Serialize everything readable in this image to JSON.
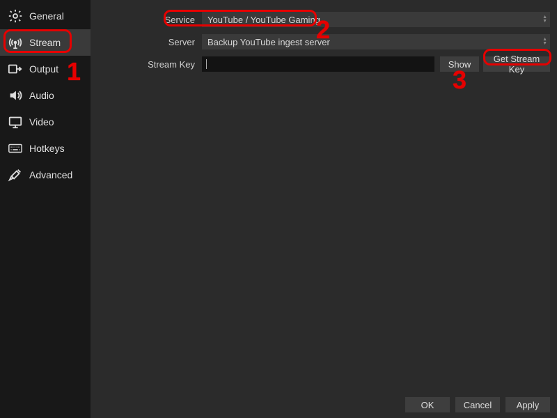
{
  "sidebar": {
    "items": [
      {
        "label": "General",
        "icon": "gear-icon"
      },
      {
        "label": "Stream",
        "icon": "antenna-icon",
        "active": true
      },
      {
        "label": "Output",
        "icon": "output-icon"
      },
      {
        "label": "Audio",
        "icon": "speaker-icon"
      },
      {
        "label": "Video",
        "icon": "monitor-icon"
      },
      {
        "label": "Hotkeys",
        "icon": "keyboard-icon"
      },
      {
        "label": "Advanced",
        "icon": "tools-icon"
      }
    ]
  },
  "form": {
    "service_label": "Service",
    "service_value": "YouTube / YouTube Gaming",
    "server_label": "Server",
    "server_value": "Backup YouTube ingest server",
    "streamkey_label": "Stream Key",
    "streamkey_value": "",
    "show_button": "Show",
    "getkey_button": "Get Stream Key"
  },
  "footer": {
    "ok": "OK",
    "cancel": "Cancel",
    "apply": "Apply"
  },
  "annotations": {
    "n1": "1",
    "n2": "2",
    "n3": "3"
  }
}
